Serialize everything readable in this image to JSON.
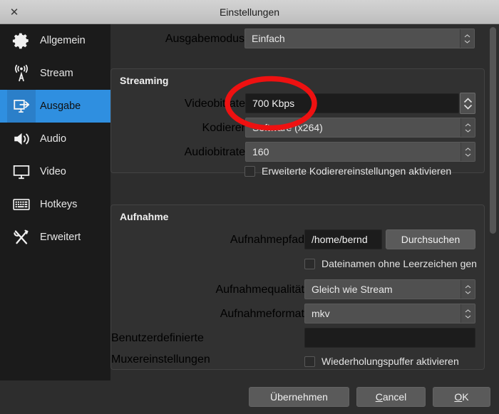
{
  "window": {
    "title": "Einstellungen",
    "close_icon": "close-x-icon"
  },
  "sidebar": {
    "items": [
      {
        "label": "Allgemein",
        "icon": "gear-icon",
        "selected": false
      },
      {
        "label": "Stream",
        "icon": "broadcast-antenna-icon",
        "selected": false
      },
      {
        "label": "Ausgabe",
        "icon": "monitor-arrow-out-icon",
        "selected": true
      },
      {
        "label": "Audio",
        "icon": "speaker-icon",
        "selected": false
      },
      {
        "label": "Video",
        "icon": "monitor-icon",
        "selected": false
      },
      {
        "label": "Hotkeys",
        "icon": "keyboard-icon",
        "selected": false
      },
      {
        "label": "Erweitert",
        "icon": "wrench-screwdriver-icon",
        "selected": false
      }
    ]
  },
  "main": {
    "output_mode": {
      "label": "Ausgabemodus",
      "value": "Einfach"
    },
    "streaming": {
      "title": "Streaming",
      "video_bitrate": {
        "label": "Videobitrate",
        "value": "700 Kbps"
      },
      "encoder": {
        "label": "Kodierer",
        "value": "Software (x264)"
      },
      "audio_bitrate": {
        "label": "Audiobitrate",
        "value": "160"
      },
      "advanced_encoder": {
        "label": "Erweiterte Kodierereinstellungen aktivieren",
        "checked": false
      }
    },
    "recording": {
      "title": "Aufnahme",
      "path": {
        "label": "Aufnahmepfad",
        "value": "/home/bernd"
      },
      "browse_button": "Durchsuchen",
      "no_space_filenames": {
        "label": "Dateinamen ohne Leerzeichen gen",
        "checked": false
      },
      "quality": {
        "label": "Aufnahmequalität",
        "value": "Gleich wie Stream"
      },
      "format": {
        "label": "Aufnahmeformat",
        "value": "mkv"
      },
      "muxer": {
        "label": "Benutzerdefinierte Muxereinstellungen",
        "value": ""
      },
      "replay_buffer": {
        "label": "Wiederholungspuffer aktivieren",
        "checked": false
      }
    }
  },
  "footer": {
    "apply": "Übernehmen",
    "cancel": "Cancel",
    "ok": "OK"
  },
  "annotation": {
    "shape": "red-ellipse-highlight",
    "color": "#ee1111",
    "target": "Videobitrate"
  },
  "colors": {
    "accent_blue": "#2f8fe0",
    "panel_bg": "#313131",
    "window_bg": "#2d2d2d",
    "sidebar_bg": "#1b1b1b",
    "titlebar_bg": "#c8c8c8",
    "annotation_red": "#ee1111"
  }
}
